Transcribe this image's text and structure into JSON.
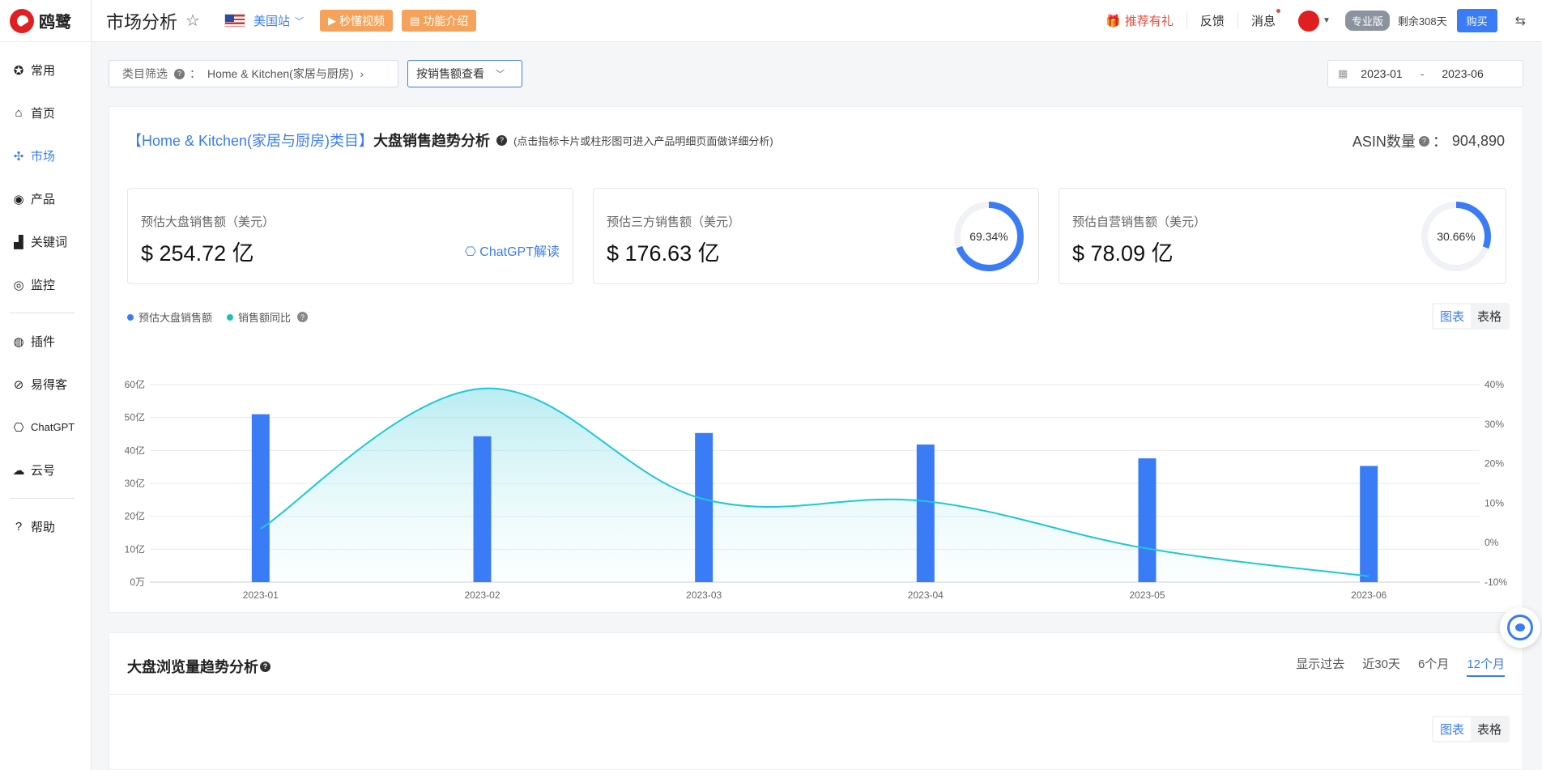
{
  "brand": {
    "name": "鸥鹭"
  },
  "sidebar": {
    "items": [
      {
        "label": "常用",
        "icon": "star-badge-icon"
      },
      {
        "label": "首页",
        "icon": "home-icon"
      },
      {
        "label": "市场",
        "icon": "grid-icon",
        "active": true
      },
      {
        "label": "产品",
        "icon": "eye-icon"
      },
      {
        "label": "关键词",
        "icon": "bar-chart-icon"
      },
      {
        "label": "监控",
        "icon": "monitor-icon"
      }
    ],
    "items2": [
      {
        "label": "插件",
        "icon": "chrome-icon"
      },
      {
        "label": "易得客",
        "icon": "link-icon"
      },
      {
        "label": "ChatGPT",
        "icon": "chatgpt-icon"
      },
      {
        "label": "云号",
        "icon": "cloud-icon"
      }
    ],
    "items3": [
      {
        "label": "帮助",
        "icon": "help-icon"
      }
    ]
  },
  "header": {
    "title": "市场分析",
    "site": "美国站",
    "video_btn": "秒懂视频",
    "intro_btn": "功能介绍",
    "gift": "推荐有礼",
    "feedback": "反馈",
    "messages": "消息",
    "plan": "专业版",
    "remaining": "剩余308天",
    "buy": "购买"
  },
  "filters": {
    "category_label": "类目筛选",
    "category_sep": "：",
    "category_value": "Home & Kitchen(家居与厨房)",
    "sort": "按销售额查看",
    "date_start": "2023-01",
    "date_sep": "-",
    "date_end": "2023-06"
  },
  "overview": {
    "head_category": "【Home & Kitchen(家居与厨房)类目】",
    "head_title": "大盘销售趋势分析",
    "head_note": "(点击指标卡片或柱形图可进入产品明细页面做详细分析)",
    "asin_label": "ASIN数量",
    "asin_sep": "：",
    "asin_value": "904,890",
    "metrics": [
      {
        "label": "预估大盘销售额（美元）",
        "value": "$ 254.72 亿",
        "link": "ChatGPT解读"
      },
      {
        "label": "预估三方销售额（美元）",
        "value": "$ 176.63 亿",
        "ring_text": "69.34%",
        "ring_fraction": 0.6934
      },
      {
        "label": "预估自营销售额（美元）",
        "value": "$ 78.09 亿",
        "ring_text": "30.66%",
        "ring_fraction": 0.3066
      }
    ],
    "legend": [
      {
        "label": "预估大盘销售额",
        "color": "#3a7cf6"
      },
      {
        "label": "销售额同比",
        "color": "#19c3b4"
      }
    ],
    "toggle": {
      "chart": "图表",
      "table": "表格"
    }
  },
  "chart_data": {
    "type": "bar",
    "categories": [
      "2023-01",
      "2023-02",
      "2023-03",
      "2023-04",
      "2023-05",
      "2023-06"
    ],
    "series": [
      {
        "name": "预估大盘销售额",
        "type": "bar",
        "values": [
          51,
          44.3,
          45.3,
          41.8,
          37.6,
          35.3
        ],
        "color": "#3a7cf6",
        "axis": "left"
      },
      {
        "name": "销售额同比",
        "type": "line",
        "values": [
          3.5,
          39,
          11,
          10.5,
          -1.5,
          -8.5
        ],
        "color": "#1ec8d8",
        "axis": "right"
      }
    ],
    "y_left": {
      "ticks": [
        "0万",
        "10亿",
        "20亿",
        "30亿",
        "40亿",
        "50亿",
        "60亿"
      ],
      "range": [
        0,
        60
      ]
    },
    "y_right": {
      "ticks": [
        "-10%",
        "0%",
        "10%",
        "20%",
        "30%",
        "40%"
      ],
      "range": [
        -10,
        40
      ]
    },
    "grid": true
  },
  "traffic": {
    "title": "大盘浏览量趋势分析",
    "ranges": [
      "显示过去",
      "近30天",
      "6个月",
      "12个月"
    ],
    "active_range": "12个月",
    "toggle": {
      "chart": "图表",
      "table": "表格"
    }
  }
}
